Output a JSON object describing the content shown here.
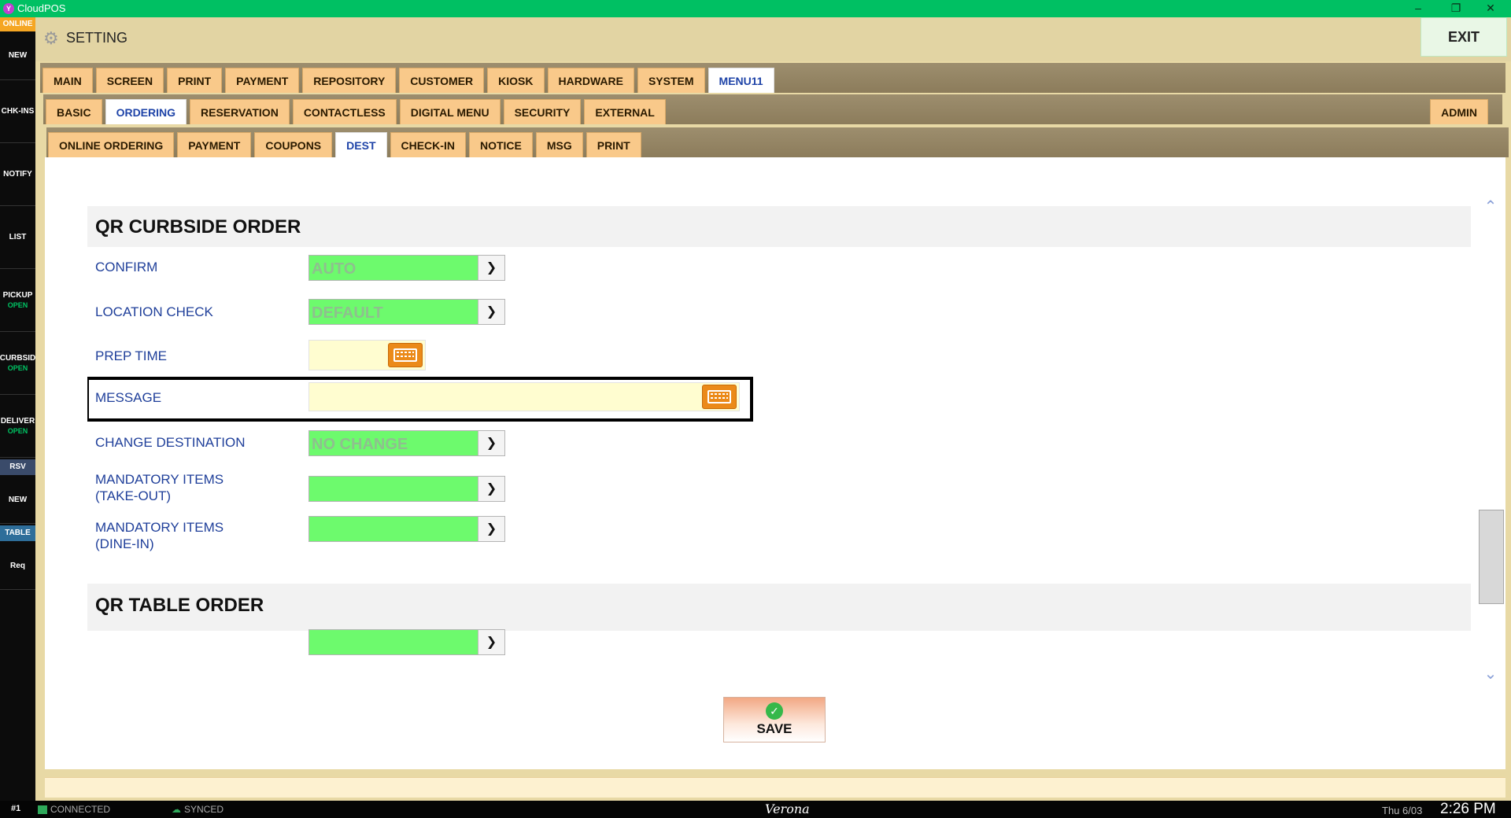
{
  "window": {
    "app_title": "CloudPOS",
    "app_icon_letter": "Y",
    "minimize": "–",
    "restore": "❐",
    "close": "✕"
  },
  "sidebar": {
    "status": "ONLINE",
    "items": [
      {
        "label": "NEW",
        "sub": ""
      },
      {
        "label": "CHK-INS",
        "sub": ""
      },
      {
        "label": "NOTIFY",
        "sub": ""
      },
      {
        "label": "LIST",
        "sub": ""
      },
      {
        "label": "PICKUP",
        "sub": "OPEN"
      },
      {
        "label": "CURBSID",
        "sub": "OPEN"
      },
      {
        "label": "DELIVER",
        "sub": "OPEN"
      }
    ],
    "rsv_tag": "RSV",
    "new2": "NEW",
    "table_tag": "TABLE",
    "req": "Req"
  },
  "header": {
    "title": "SETTING",
    "exit_label": "EXIT"
  },
  "tabs_level1": [
    "MAIN",
    "SCREEN",
    "PRINT",
    "PAYMENT",
    "REPOSITORY",
    "CUSTOMER",
    "KIOSK",
    "HARDWARE",
    "SYSTEM",
    "MENU11"
  ],
  "tabs_level1_active": "MENU11",
  "tabs_level2": [
    "BASIC",
    "ORDERING",
    "RESERVATION",
    "CONTACTLESS",
    "DIGITAL MENU",
    "SECURITY",
    "EXTERNAL"
  ],
  "tabs_level2_active": "ORDERING",
  "admin_tab": "ADMIN",
  "tabs_level3": [
    "ONLINE ORDERING",
    "PAYMENT",
    "COUPONS",
    "DEST",
    "CHECK-IN",
    "NOTICE",
    "MSG",
    "PRINT"
  ],
  "tabs_level3_active": "DEST",
  "section1": {
    "title": "QR CURBSIDE ORDER",
    "confirm": {
      "label": "CONFIRM",
      "value": "AUTO"
    },
    "location_check": {
      "label": "LOCATION CHECK",
      "value": "DEFAULT"
    },
    "prep_time": {
      "label": "PREP TIME",
      "value": ""
    },
    "message": {
      "label": "MESSAGE",
      "value": ""
    },
    "change_destination": {
      "label": "CHANGE DESTINATION",
      "value": "NO CHANGE"
    },
    "mandatory_takeout": {
      "label1": "MANDATORY ITEMS",
      "label2": "(TAKE-OUT)",
      "value": ""
    },
    "mandatory_dinein": {
      "label1": "MANDATORY ITEMS",
      "label2": "(DINE-IN)",
      "value": ""
    }
  },
  "section2": {
    "title": "QR TABLE ORDER"
  },
  "save_label": "SAVE",
  "status": {
    "station": "#1",
    "connected": "CONNECTED",
    "synced": "SYNCED",
    "location": "Verona",
    "date": "Thu 6/03",
    "time": "2:26 PM"
  },
  "colors": {
    "accent_green": "#00c063",
    "dropdown_green": "#6dfa6d",
    "tab_orange": "#f9c98a",
    "label_blue": "#1f3f9a",
    "keyboard_orange": "#eb8a19"
  }
}
